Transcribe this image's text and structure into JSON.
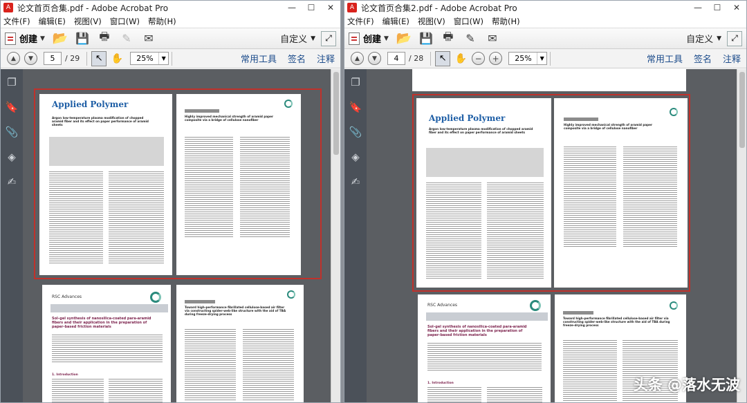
{
  "left_window": {
    "title": "论文首页合集.pdf - Adobe Acrobat Pro",
    "menu": [
      "文件(F)",
      "编辑(E)",
      "视图(V)",
      "窗口(W)",
      "帮助(H)"
    ],
    "create_label": "创建",
    "customize_label": "自定义",
    "page_current": "5",
    "page_total": "/ 29",
    "zoom": "25%",
    "tool_links": [
      "常用工具",
      "签名",
      "注释"
    ],
    "pages": {
      "paper1_journal": "Applied Polymer",
      "paper1_title": "Argon low-temperature plasma modification of chopped aramid fiber and its effect on paper performance of aramid sheets",
      "paper2_title": "Highly improved mechanical strength of aramid paper composite via a bridge of cellulose nanofiber",
      "paper3_journal": "RSC Advances",
      "paper3_title": "Sol–gel synthesis of nanosilica-coated para-aramid fibers and their application in the preparation of paper-based friction materials",
      "paper4_title": "Toward high-performance fibrillated cellulose-based air filter via constructing spider-web-like structure with the aid of TBA during freeze-drying process",
      "paper3_section": "1. Introduction"
    }
  },
  "right_window": {
    "title": "论文首页合集2.pdf - Adobe Acrobat Pro",
    "menu": [
      "文件(F)",
      "编辑(E)",
      "视图(V)",
      "窗口(W)",
      "帮助(H)"
    ],
    "create_label": "创建",
    "customize_label": "自定义",
    "page_current": "4",
    "page_total": "/ 28",
    "zoom": "25%",
    "tool_links": [
      "常用工具",
      "签名",
      "注释"
    ],
    "pages": {
      "paper1_journal": "Applied Polymer",
      "paper1_title": "Argon low-temperature plasma modification of chopped aramid fiber and its effect on paper performance of aramid sheets",
      "paper2_title": "Highly improved mechanical strength of aramid paper composite via a bridge of cellulose nanofiber",
      "paper3_journal": "RSC Advances",
      "paper3_title": "Sol–gel synthesis of nanosilica-coated para-aramid fibers and their application in the preparation of paper-based friction materials",
      "paper4_title": "Toward high-performance fibrillated cellulose-based air filter via constructing spider-web-like structure with the aid of TBA during freeze-drying process",
      "paper3_section": "1. Introduction"
    }
  },
  "watermark": "头条 @落水无波",
  "colors": {
    "selection": "#c0312b",
    "tools_link": "#1e4d8c",
    "nav_pane": "#4b5159"
  }
}
